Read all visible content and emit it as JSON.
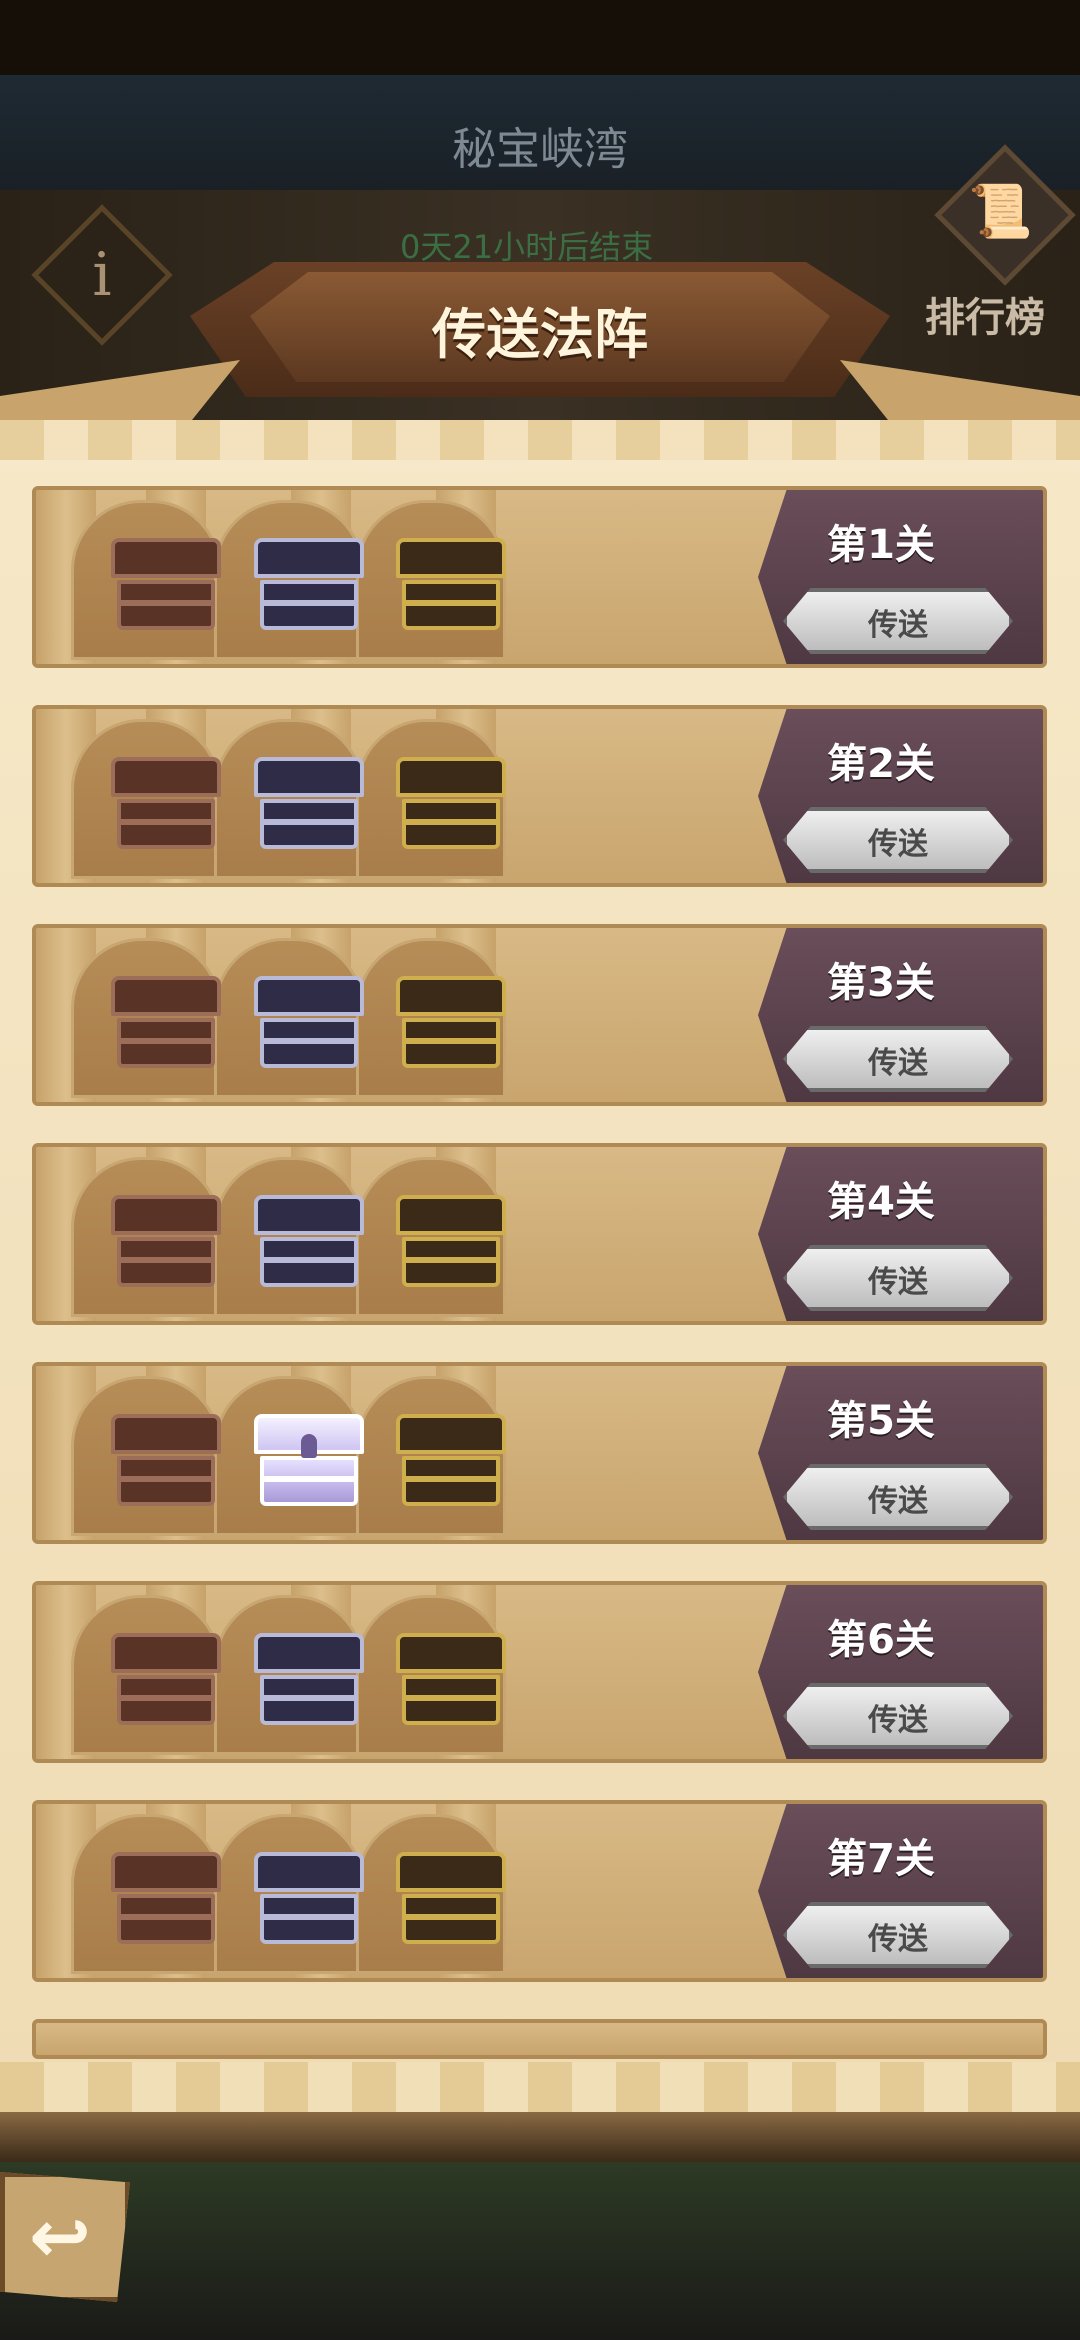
{
  "header": {
    "location_title": "秘宝峡湾",
    "timer_text": "0天21小时后结束",
    "panel_title": "传送法阵",
    "rank_label": "排行榜",
    "info_glyph": "i",
    "rank_glyph": "📜"
  },
  "stages": [
    {
      "label": "第1关",
      "button": "传送",
      "chests": [
        "bronze",
        "silver",
        "gold"
      ]
    },
    {
      "label": "第2关",
      "button": "传送",
      "chests": [
        "bronze",
        "silver",
        "gold"
      ]
    },
    {
      "label": "第3关",
      "button": "传送",
      "chests": [
        "bronze",
        "silver",
        "gold"
      ]
    },
    {
      "label": "第4关",
      "button": "传送",
      "chests": [
        "bronze",
        "silver",
        "gold"
      ]
    },
    {
      "label": "第5关",
      "button": "传送",
      "chests": [
        "bronze",
        "silver-opened",
        "gold"
      ]
    },
    {
      "label": "第6关",
      "button": "传送",
      "chests": [
        "bronze",
        "silver",
        "gold"
      ]
    },
    {
      "label": "第7关",
      "button": "传送",
      "chests": [
        "bronze",
        "silver",
        "gold"
      ]
    }
  ],
  "footer": {
    "back_glyph": "↩"
  },
  "colors": {
    "panel": "#efdcb4",
    "stage_band": "#5a4150",
    "send_button": "#d9d9d9",
    "banner": "#6a4126"
  }
}
